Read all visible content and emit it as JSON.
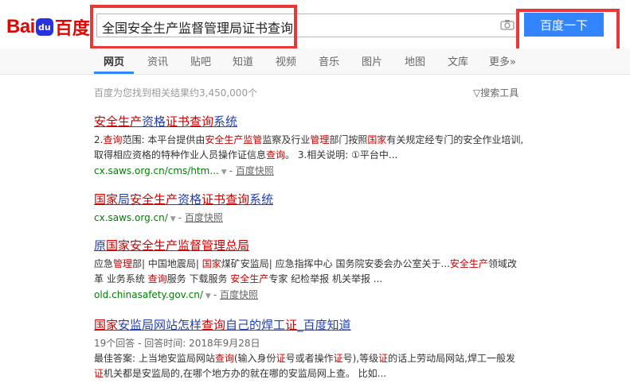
{
  "logo": {
    "bai": "Bai",
    "paw": "du",
    "du": "百度"
  },
  "search": {
    "query": "全国安全生产监督管理局证书查询",
    "button": "百度一下"
  },
  "tabs": [
    "网页",
    "资讯",
    "贴吧",
    "知道",
    "视频",
    "音乐",
    "图片",
    "地图",
    "文库",
    "更多»"
  ],
  "result_count": "百度为您找到相关结果约3,450,000个",
  "tools": "搜索工具",
  "results": [
    {
      "title": "安全生产资格证书查询系统",
      "abstract": "2.查询范围: 本平台提供由安全生产监管监察及行业管理部门按照国家有关规定经专门的安全作业培训,取得相应资格的特种作业人员操作证信息查询。 3.相关说明: ①平台中...",
      "url": "cx.saws.org.cn/cms/htm...",
      "cache": "百度快照"
    },
    {
      "title": "国家局安全生产资格证书查询系统",
      "url": "cx.saws.org.cn/",
      "cache": "百度快照"
    },
    {
      "title": "原国家安全生产监督管理总局",
      "abstract": "应急管理部| 中国地震局| 国家煤矿安监局| 应急指挥中心 国务院安委会办公室关于...安全生产领域改革 业务系统 查询服务 下载服务 安全生产专家 纪检举报 机关举报 ...",
      "url": "old.chinasafety.gov.cn/",
      "cache": "百度快照"
    },
    {
      "title": "国家安监局网站怎样查询自己的焊工证_百度知道",
      "meta": "19个回答 - 回答时间: 2018年9月28日",
      "abstract": "最佳答案: 上当地安监局网站查询(输入身份证号或者操作证号),等级证的话上劳动局网站,焊工一般发证机关都是安监局的,在哪个地方办的就在哪的安监局网上查。 比如..."
    }
  ]
}
